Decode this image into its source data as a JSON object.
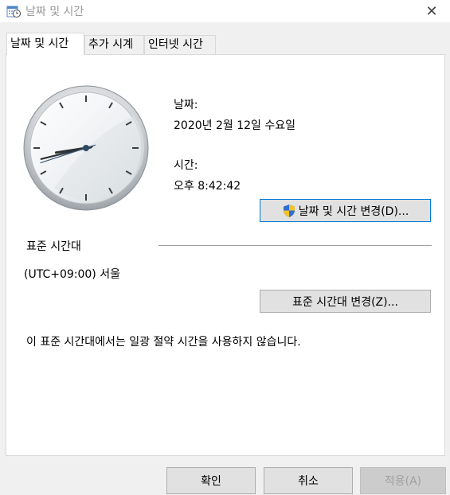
{
  "window": {
    "title": "날짜 및 시간",
    "close_glyph": "✕"
  },
  "tabs": [
    {
      "label": "날짜 및 시간",
      "active": true
    },
    {
      "label": "추가 시계",
      "active": false
    },
    {
      "label": "인터넷 시간",
      "active": false
    }
  ],
  "datetime": {
    "date_label": "날짜:",
    "date_value": "2020년 2월 12일 수요일",
    "time_label": "시간:",
    "time_value": "오후 8:42:42",
    "change_button": "날짜 및 시간 변경(D)..."
  },
  "timezone": {
    "section_label": "표준 시간대",
    "value": "(UTC+09:00) 서울",
    "change_button": "표준 시간대 변경(Z)...",
    "dst_note": "이 표준 시간대에서는 일광 절약 시간을 사용하지 않습니다."
  },
  "footer": {
    "ok": "확인",
    "cancel": "취소",
    "apply": "적용(A)"
  },
  "clock": {
    "hour": 8,
    "minute": 42,
    "second": 42
  },
  "icons": {
    "title": "date-time-icon",
    "shield": "uac-shield-icon",
    "close": "close-icon"
  },
  "colors": {
    "focus_border": "#0078d7",
    "button_bg": "#e1e1e1"
  }
}
